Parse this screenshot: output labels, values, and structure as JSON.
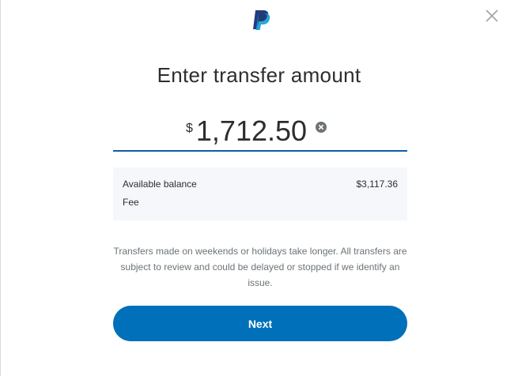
{
  "header": {
    "logo_icon": "paypal-logo-icon",
    "close_icon": "close-icon"
  },
  "title": "Enter transfer amount",
  "amount": {
    "currency_symbol": "$",
    "value": "1,712.50",
    "clear_icon": "clear-circle-icon"
  },
  "summary": {
    "available_balance_label": "Available balance",
    "available_balance_value": "$3,117.36",
    "fee_label": "Fee"
  },
  "disclaimer": "Transfers made on weekends or holidays take longer. All transfers are subject to review and could be delayed or stopped if we identify an issue.",
  "next_button_label": "Next",
  "colors": {
    "primary_button": "#0070ba",
    "underline": "#0b5ea8",
    "summary_bg": "#f5f7fa",
    "text_primary": "#2c2e2f",
    "text_muted": "#6c7378",
    "logo_dark": "#253b80",
    "logo_light": "#179bd7"
  }
}
